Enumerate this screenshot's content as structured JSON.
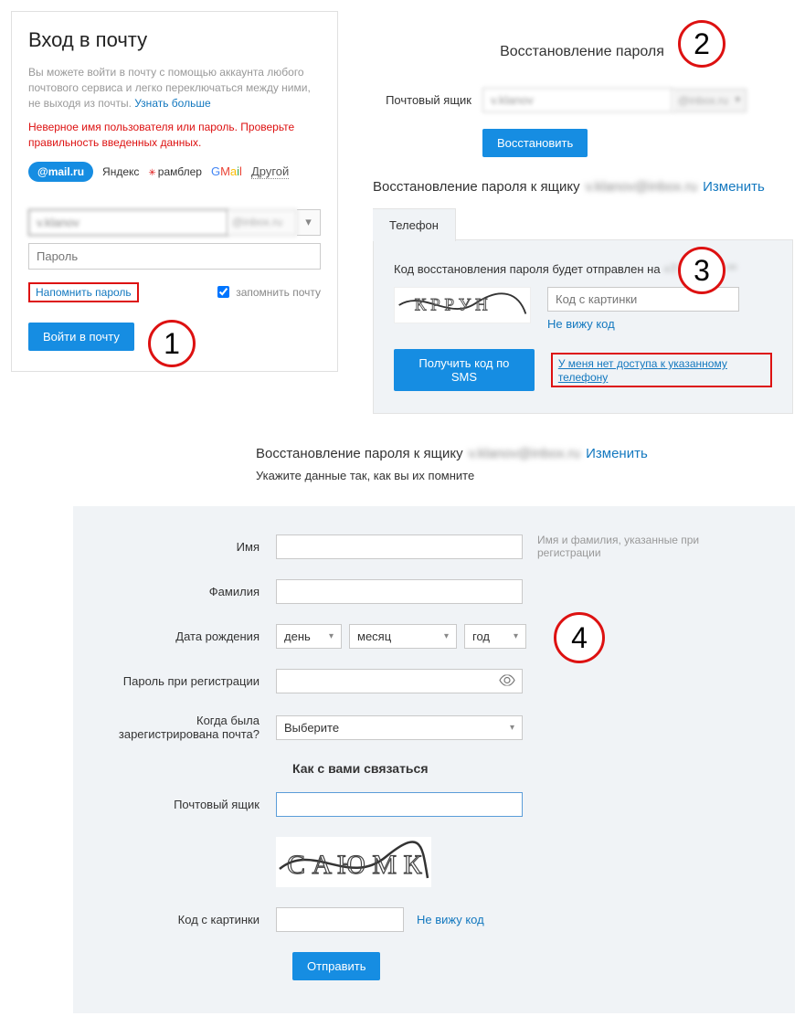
{
  "login": {
    "title": "Вход в почту",
    "desc_pre": "Вы можете войти в почту с помощью аккаунта любого почтового сервиса и легко переключаться между ними, не выходя из почты. ",
    "desc_link": "Узнать больше",
    "error": "Неверное имя пользователя или пароль. Проверьте правильность введенных данных.",
    "providers": {
      "mail": "@mail.ru",
      "yandex": "Яндекс",
      "rambler": "рамблер",
      "gmail": [
        "G",
        "M",
        "a",
        "i",
        "l"
      ],
      "other": "Другой"
    },
    "email_value": "v.klanov",
    "domain_value": "@inbox.ru",
    "password_placeholder": "Пароль",
    "remind_link": "Напомнить пароль",
    "remember_label": "запомнить почту",
    "submit": "Войти в почту"
  },
  "recov_top": {
    "title": "Восстановление пароля",
    "mailbox_label": "Почтовый ящик",
    "mailbox_value": "v.klanov",
    "domain_value": "@inbox.ru",
    "submit": "Восстановить"
  },
  "recov_mid": {
    "title_pre": "Восстановление пароля к ящику",
    "mailbox_blur": "v.klanov@inbox.ru",
    "change_link": "Изменить",
    "tab_phone": "Телефон",
    "phone_msg_pre": "Код восстановления пароля будет отправлен на ",
    "phone_blur": "+7 *** *** ** **",
    "captcha_placeholder": "Код с картинки",
    "nocaptcha_link": "Не вижу код",
    "sms_btn": "Получить код по SMS",
    "noaccess_link": "У меня нет доступа к указанному телефону"
  },
  "recov_form": {
    "title_pre": "Восстановление пароля к ящику",
    "mailbox_blur": "v.klanov@inbox.ru",
    "change_link": "Изменить",
    "subtitle": "Укажите данные так, как вы их помните",
    "name_label": "Имя",
    "name_hint": "Имя и фамилия, указанные при регистрации",
    "surname_label": "Фамилия",
    "dob_label": "Дата рождения",
    "day": "день",
    "month": "месяц",
    "year": "год",
    "regpwd_label": "Пароль при регистрации",
    "when_label": "Когда была зарегистрирована почта?",
    "when_value": "Выберите",
    "contact_heading": "Как с вами связаться",
    "contact_mail_label": "Почтовый ящик",
    "captcha_label": "Код с картинки",
    "nocaptcha_link": "Не вижу код",
    "submit": "Отправить"
  },
  "circles": {
    "c1": "1",
    "c2": "2",
    "c3": "3",
    "c4": "4"
  }
}
